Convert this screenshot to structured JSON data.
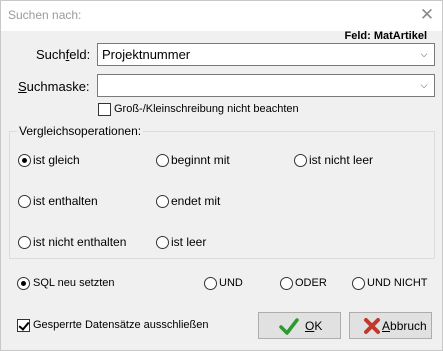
{
  "window": {
    "title": "Suchen nach:",
    "field_info": "Feld: MatArtikel"
  },
  "suchfeld": {
    "label_pre": "Such",
    "label_accel": "f",
    "label_post": "eld:",
    "value": "Projektnummer"
  },
  "suchmaske": {
    "label_accel": "S",
    "label_post": "uchmaske:",
    "value": ""
  },
  "case_option": {
    "label": "Groß-/Kleinschreibung nicht beachten",
    "checked": false
  },
  "vergleich": {
    "title": "Vergleichsoperationen:",
    "options": [
      {
        "label": "ist gleich",
        "checked": true
      },
      {
        "label": "beginnt mit",
        "checked": false
      },
      {
        "label": "ist nicht leer",
        "checked": false
      },
      {
        "label": "ist enthalten",
        "checked": false
      },
      {
        "label": "endet mit",
        "checked": false
      },
      {
        "label": "ist nicht enthalten",
        "checked": false
      },
      {
        "label": "ist leer",
        "checked": false
      }
    ]
  },
  "sql_mode": {
    "options": [
      {
        "label": "SQL neu setzten",
        "checked": true
      },
      {
        "label": "UND",
        "checked": false
      },
      {
        "label": "ODER",
        "checked": false
      },
      {
        "label": "UND NICHT",
        "checked": false
      }
    ]
  },
  "locked_option": {
    "label": "Gesperrte Datensätze ausschließen",
    "checked": true
  },
  "buttons": {
    "ok_accel": "O",
    "ok_post": "K",
    "cancel_accel": "A",
    "cancel_post": "bbruch"
  },
  "colors": {
    "ok_check": "#2e9a2e",
    "cancel_x": "#c0392b"
  },
  "icons": [
    "close-icon",
    "chevron-down-icon",
    "checkmark-icon",
    "cross-icon"
  ]
}
